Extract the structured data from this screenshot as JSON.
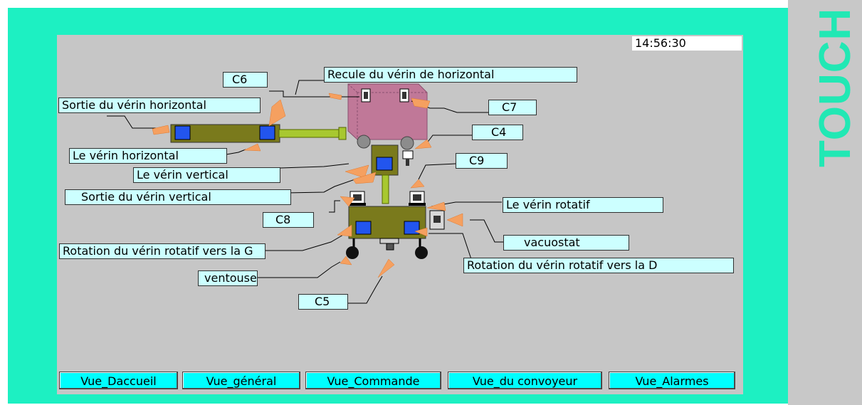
{
  "window": {
    "brand": "TOUCH",
    "clock": "14:56:30"
  },
  "labels": {
    "c6": "C6",
    "recule_horizontal": "Recule du vérin de horizontal",
    "sortie_horizontal": "Sortie du vérin horizontal",
    "c7": "C7",
    "c4": "C4",
    "verin_horizontal": "Le vérin horizontal",
    "verin_vertical": "Le vérin vertical",
    "c9": "C9",
    "sortie_vertical": "Sortie du vérin vertical",
    "verin_rotatif": "Le vérin rotatif",
    "c8": "C8",
    "vacuostat": "vacuostat",
    "rotation_g": "Rotation du vérin rotatif vers la G",
    "rotation_d": "Rotation du vérin rotatif vers la D",
    "ventouse": "ventouse",
    "c5": "C5"
  },
  "nav": [
    "Vue_Daccueil",
    "Vue_général",
    "Vue_Commande",
    "Vue_du convoyeur",
    "Vue_Alarmes"
  ],
  "colors": {
    "frame": "#1df0c2",
    "screen": "#c6c6c6",
    "label_bg": "#ccffff",
    "nav_bg": "#00ffff",
    "cylinder": "#7a7a1c",
    "magazine": "#c07898",
    "indicator": "#2255ee",
    "arrow": "#f5a060"
  }
}
